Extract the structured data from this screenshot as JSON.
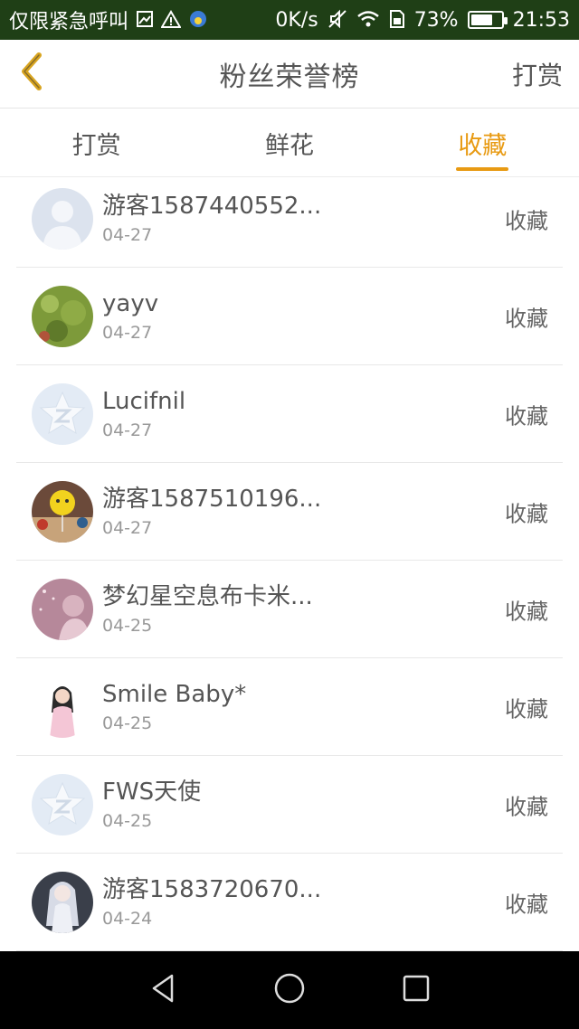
{
  "status_bar": {
    "carrier": "仅限紧急呼叫",
    "net_speed": "0K/s",
    "battery_percent": "73%",
    "battery_level": 0.73,
    "time": "21:53"
  },
  "header": {
    "title": "粉丝荣誉榜",
    "right_action": "打赏"
  },
  "tabs": [
    {
      "label": "打赏",
      "active": false
    },
    {
      "label": "鲜花",
      "active": false
    },
    {
      "label": "收藏",
      "active": true
    }
  ],
  "rows": [
    {
      "name": "游客1587440552...",
      "date": "04-27",
      "action": "收藏",
      "avatar": "default-person"
    },
    {
      "name": "yayv",
      "date": "04-27",
      "action": "收藏",
      "avatar": "photo-green"
    },
    {
      "name": "Lucifnil",
      "date": "04-27",
      "action": "收藏",
      "avatar": "qq-star"
    },
    {
      "name": "游客1587510196...",
      "date": "04-27",
      "action": "收藏",
      "avatar": "photo-balloon"
    },
    {
      "name": "梦幻星空息布卡米...",
      "date": "04-25",
      "action": "收藏",
      "avatar": "photo-girl-pink"
    },
    {
      "name": "Smile Baby*",
      "date": "04-25",
      "action": "收藏",
      "avatar": "photo-girl"
    },
    {
      "name": "FWS天使",
      "date": "04-25",
      "action": "收藏",
      "avatar": "qq-star"
    },
    {
      "name": "游客1583720670...",
      "date": "04-24",
      "action": "收藏",
      "avatar": "photo-anime"
    }
  ],
  "colors": {
    "status_bar_bg": "#1f3f16",
    "accent": "#e89a12",
    "back_arrow": "#d9a520"
  }
}
